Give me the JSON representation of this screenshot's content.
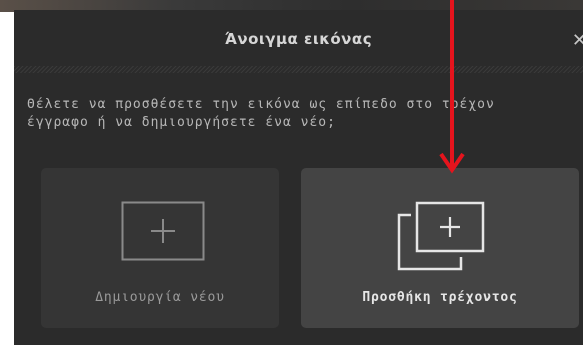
{
  "dialog": {
    "title": "Άνοιγμα εικόνας",
    "close_label": "✕",
    "message_line1": "Θέλετε να προσθέσετε την εικόνα ως επίπεδο στο τρέχον",
    "message_line2": "έγγραφο ή να δημιουργήσετε ένα νέο;"
  },
  "options": {
    "new": {
      "label": "Δημιουργία νέου",
      "icon": "new-document-icon"
    },
    "add": {
      "label": "Προσθήκη τρέχοντος",
      "icon": "add-layers-icon"
    }
  },
  "colors": {
    "dialog_bg": "#2b2b2b",
    "card_new_bg": "#353535",
    "card_add_bg": "#444444",
    "annotation_arrow": "#e5141d"
  }
}
